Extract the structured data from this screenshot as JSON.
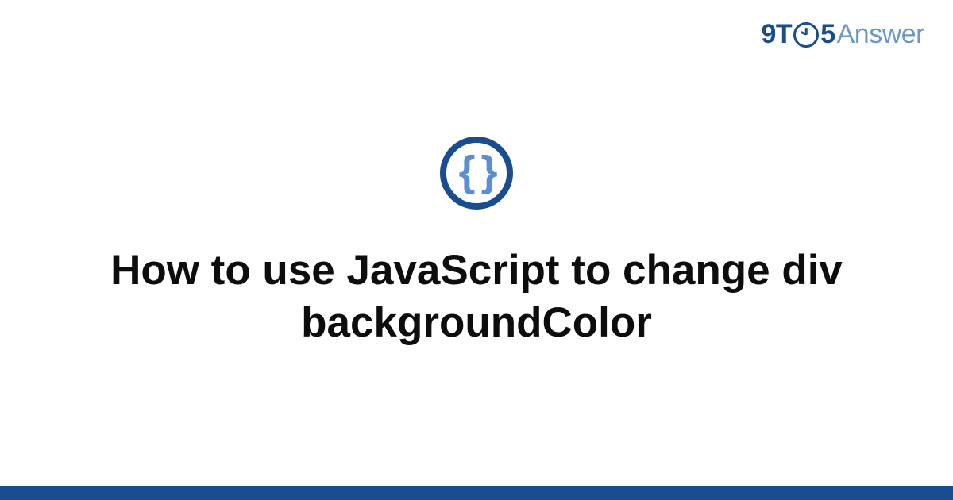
{
  "brand": {
    "part1": "9T",
    "part2": "5",
    "part3": "Answer"
  },
  "icon": {
    "glyph": "{ }"
  },
  "headline": "How to use JavaScript to change div backgroundColor",
  "colors": {
    "accent_dark": "#1a4d8f",
    "accent_light": "#5a8fd4",
    "brand_light": "#6b98c9",
    "text": "#0d0d0d"
  }
}
